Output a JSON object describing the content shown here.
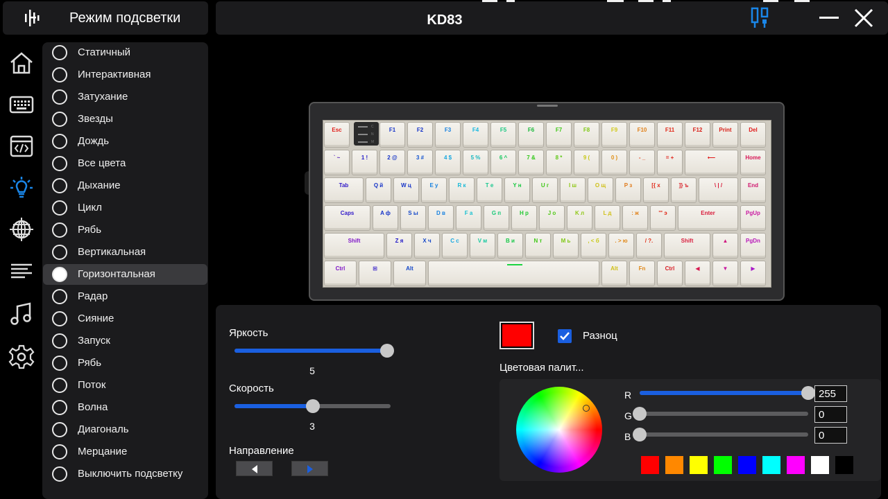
{
  "header": {
    "mode_title": "Режим подсветки",
    "device_name": "KD83"
  },
  "nav": {
    "items": [
      "home-icon",
      "keyboard-icon",
      "macro-icon",
      "lighting-icon",
      "network-icon",
      "text-align-icon",
      "music-icon",
      "gear-icon"
    ],
    "active": "lighting-icon"
  },
  "modes": {
    "selected": "Горизонтальная",
    "items": [
      "Статичный",
      "Интерактивная",
      "Затухание",
      "Звезды",
      "Дождь",
      "Все цвета",
      "Дыхание",
      "Цикл",
      "Рябь",
      "Вертикальная",
      "Горизонтальная",
      "Радар",
      "Сияние",
      "Запуск",
      "Рябь",
      "Поток",
      "Волна",
      "Диагональ",
      "Мерцание",
      "Выключить подсветку"
    ]
  },
  "keyboard": {
    "fn_indicators": [
      "C",
      "N",
      "M"
    ],
    "rows": [
      [
        [
          "Esc",
          "#e0201a"
        ],
        [
          "F1",
          "#1533c8"
        ],
        [
          "F2",
          "#1533c8"
        ],
        [
          "F3",
          "#1580e0"
        ],
        [
          "F4",
          "#18b8e0"
        ],
        [
          "F5",
          "#18c880"
        ],
        [
          "F6",
          "#18b838"
        ],
        [
          "F7",
          "#40c818"
        ],
        [
          "F8",
          "#80c818"
        ],
        [
          "F9",
          "#d0c818"
        ],
        [
          "F10",
          "#e08018"
        ],
        [
          "F11",
          "#e02818"
        ],
        [
          "F12",
          "#d82018"
        ],
        [
          "Print",
          "#d82018"
        ],
        [
          "Del",
          "#e01818"
        ]
      ],
      [
        [
          "` ~",
          "#5018b8"
        ],
        [
          "1 !",
          "#2018c8"
        ],
        [
          "2 @",
          "#1533c8"
        ],
        [
          "3 #",
          "#1555d0"
        ],
        [
          "4 $",
          "#18a8e0"
        ],
        [
          "5 %",
          "#18b8c0"
        ],
        [
          "6 ^",
          "#18c860"
        ],
        [
          "7 &",
          "#30c818"
        ],
        [
          "8 *",
          "#60c818"
        ],
        [
          "9 (",
          "#c8c818"
        ],
        [
          "0 )",
          "#e09018"
        ],
        [
          "- _",
          "#e04018"
        ],
        [
          "= +",
          "#e02018"
        ],
        [
          "⟵",
          "#e01818"
        ],
        [
          "Home",
          "#d81858"
        ]
      ],
      [
        [
          "Tab",
          "#3018c8"
        ],
        [
          "Q й",
          "#1533c8"
        ],
        [
          "W ц",
          "#1533c8"
        ],
        [
          "E у",
          "#1580e0"
        ],
        [
          "R к",
          "#18b8d8"
        ],
        [
          "T е",
          "#18c890"
        ],
        [
          "Y н",
          "#18c840"
        ],
        [
          "U г",
          "#40c818"
        ],
        [
          "I ш",
          "#90c818"
        ],
        [
          "O щ",
          "#d0c018"
        ],
        [
          "P з",
          "#e07818"
        ],
        [
          "[{ х",
          "#e02818"
        ],
        [
          "]} ъ",
          "#d82028"
        ],
        [
          "\\ | /",
          "#d81838"
        ],
        [
          "End",
          "#d01870"
        ]
      ],
      [
        [
          "Caps",
          "#3018c8"
        ],
        [
          "A ф",
          "#1533c8"
        ],
        [
          "S ы",
          "#1548c8"
        ],
        [
          "D в",
          "#1580e0"
        ],
        [
          "F а",
          "#18c0d0"
        ],
        [
          "G п",
          "#18c878"
        ],
        [
          "H р",
          "#20c830"
        ],
        [
          "J о",
          "#50c818"
        ],
        [
          "K л",
          "#90c818"
        ],
        [
          "L д",
          "#d0c018"
        ],
        [
          ": ж",
          "#e08018"
        ],
        [
          "'\" э",
          "#e02818"
        ],
        [
          "Enter",
          "#d81838"
        ],
        [
          "PgUp",
          "#c818a0"
        ]
      ],
      [
        [
          "Shift",
          "#8018c8"
        ],
        [
          "Z я",
          "#2018c8"
        ],
        [
          "X ч",
          "#1548c8"
        ],
        [
          "C с",
          "#18a8e0"
        ],
        [
          "V м",
          "#18c8a0"
        ],
        [
          "B и",
          "#18c848"
        ],
        [
          "N т",
          "#40c818"
        ],
        [
          "M ь",
          "#80c818"
        ],
        [
          ", < б",
          "#c8c818"
        ],
        [
          ". > ю",
          "#e08818"
        ],
        [
          "/ ?.",
          "#e03018"
        ],
        [
          "Shift",
          "#d82040"
        ],
        [
          "▲",
          "#d01880"
        ],
        [
          "PgDn",
          "#b818b8"
        ]
      ],
      [
        [
          "Ctrl",
          "#8018c8"
        ],
        [
          "⊞",
          "#3018c8"
        ],
        [
          "Alt",
          "#1548c8"
        ],
        [
          "",
          "#18c840"
        ],
        [
          "Alt",
          "#d0c018"
        ],
        [
          "Fn",
          "#e08818"
        ],
        [
          "Ctrl",
          "#d82028"
        ],
        [
          "◀",
          "#d81850"
        ],
        [
          "▼",
          "#c818a0"
        ],
        [
          "▶",
          "#a818c8"
        ]
      ]
    ]
  },
  "controls": {
    "brightness": {
      "label": "Яркость",
      "value": 5,
      "max": 5
    },
    "speed": {
      "label": "Скорость",
      "value": 3,
      "max": 5
    },
    "direction": {
      "label": "Направление"
    },
    "multicolor": {
      "label": "Разноц",
      "checked": true
    },
    "palette_label": "Цветовая палит...",
    "current_color": "#ff0000"
  },
  "rgb": {
    "r": {
      "label": "R",
      "value": "255",
      "num": 255
    },
    "g": {
      "label": "G",
      "value": "0",
      "num": 0
    },
    "b": {
      "label": "B",
      "value": "0",
      "num": 0
    }
  },
  "swatches": [
    "#ff0000",
    "#ff8800",
    "#ffff00",
    "#00ff00",
    "#0000ff",
    "#00ffff",
    "#ff00ff",
    "#ffffff",
    "#000000"
  ],
  "colors": {
    "accent": "#1a5fe0",
    "panel": "#1b1b1d",
    "selected_mode": "#3a3a3d"
  }
}
